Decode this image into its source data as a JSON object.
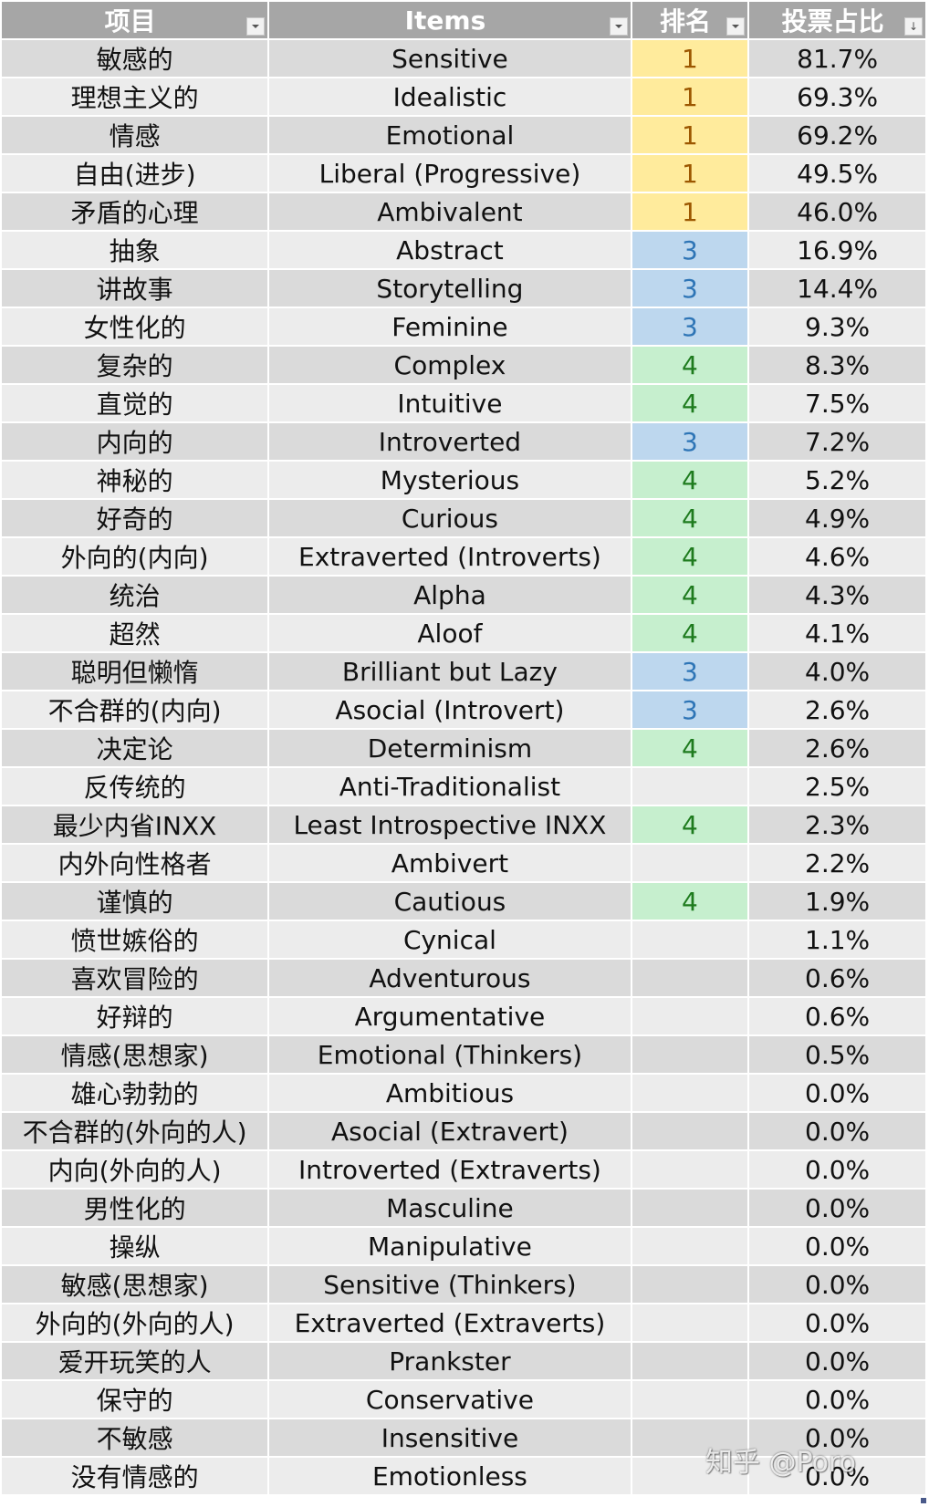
{
  "header": {
    "col_cn": "项目",
    "col_en": "Items",
    "col_rank": "排名",
    "col_pct": "投票占比",
    "filter_icon": "dropdown-triangle",
    "sort_icon": "sort-descending",
    "sort_glyph": "↓"
  },
  "colors": {
    "rank_1_bg": "#ffeb9c",
    "rank_1_text": "#9c5700",
    "rank_3_bg": "#bdd7ee",
    "rank_3_text": "#2e75b6",
    "rank_4_bg": "#c6efce",
    "rank_4_text": "#1e7b1e",
    "header_bg": "#a6a6a6"
  },
  "rows": [
    {
      "cn": "敏感的",
      "en": "Sensitive",
      "rank": "1",
      "pct": "81.7%"
    },
    {
      "cn": "理想主义的",
      "en": "Idealistic",
      "rank": "1",
      "pct": "69.3%"
    },
    {
      "cn": "情感",
      "en": "Emotional",
      "rank": "1",
      "pct": "69.2%"
    },
    {
      "cn": "自由(进步)",
      "en": "Liberal (Progressive)",
      "rank": "1",
      "pct": "49.5%"
    },
    {
      "cn": "矛盾的心理",
      "en": "Ambivalent",
      "rank": "1",
      "pct": "46.0%"
    },
    {
      "cn": "抽象",
      "en": "Abstract",
      "rank": "3",
      "pct": "16.9%"
    },
    {
      "cn": "讲故事",
      "en": "Storytelling",
      "rank": "3",
      "pct": "14.4%"
    },
    {
      "cn": "女性化的",
      "en": "Feminine",
      "rank": "3",
      "pct": "9.3%"
    },
    {
      "cn": "复杂的",
      "en": "Complex",
      "rank": "4",
      "pct": "8.3%"
    },
    {
      "cn": "直觉的",
      "en": "Intuitive",
      "rank": "4",
      "pct": "7.5%"
    },
    {
      "cn": "内向的",
      "en": "Introverted",
      "rank": "3",
      "pct": "7.2%"
    },
    {
      "cn": "神秘的",
      "en": "Mysterious",
      "rank": "4",
      "pct": "5.2%"
    },
    {
      "cn": "好奇的",
      "en": "Curious",
      "rank": "4",
      "pct": "4.9%"
    },
    {
      "cn": "外向的(内向)",
      "en": "Extraverted (Introverts)",
      "rank": "4",
      "pct": "4.6%"
    },
    {
      "cn": "统治",
      "en": "Alpha",
      "rank": "4",
      "pct": "4.3%"
    },
    {
      "cn": "超然",
      "en": "Aloof",
      "rank": "4",
      "pct": "4.1%"
    },
    {
      "cn": "聪明但懒惰",
      "en": "Brilliant but Lazy",
      "rank": "3",
      "pct": "4.0%"
    },
    {
      "cn": "不合群的(内向)",
      "en": "Asocial (Introvert)",
      "rank": "3",
      "pct": "2.6%"
    },
    {
      "cn": "决定论",
      "en": "Determinism",
      "rank": "4",
      "pct": "2.6%"
    },
    {
      "cn": "反传统的",
      "en": "Anti-Traditionalist",
      "rank": "",
      "pct": "2.5%"
    },
    {
      "cn": "最少内省INXX",
      "en": "Least Introspective INXX",
      "rank": "4",
      "pct": "2.3%"
    },
    {
      "cn": "内外向性格者",
      "en": "Ambivert",
      "rank": "",
      "pct": "2.2%"
    },
    {
      "cn": "谨慎的",
      "en": "Cautious",
      "rank": "4",
      "pct": "1.9%"
    },
    {
      "cn": "愤世嫉俗的",
      "en": "Cynical",
      "rank": "",
      "pct": "1.1%"
    },
    {
      "cn": "喜欢冒险的",
      "en": "Adventurous",
      "rank": "",
      "pct": "0.6%"
    },
    {
      "cn": "好辩的",
      "en": "Argumentative",
      "rank": "",
      "pct": "0.6%"
    },
    {
      "cn": "情感(思想家)",
      "en": "Emotional (Thinkers)",
      "rank": "",
      "pct": "0.5%"
    },
    {
      "cn": "雄心勃勃的",
      "en": "Ambitious",
      "rank": "",
      "pct": "0.0%"
    },
    {
      "cn": "不合群的(外向的人)",
      "en": "Asocial (Extravert)",
      "rank": "",
      "pct": "0.0%"
    },
    {
      "cn": "内向(外向的人)",
      "en": "Introverted (Extraverts)",
      "rank": "",
      "pct": "0.0%"
    },
    {
      "cn": "男性化的",
      "en": "Masculine",
      "rank": "",
      "pct": "0.0%"
    },
    {
      "cn": "操纵",
      "en": "Manipulative",
      "rank": "",
      "pct": "0.0%"
    },
    {
      "cn": "敏感(思想家)",
      "en": "Sensitive (Thinkers)",
      "rank": "",
      "pct": "0.0%"
    },
    {
      "cn": "外向的(外向的人)",
      "en": "Extraverted (Extraverts)",
      "rank": "",
      "pct": "0.0%"
    },
    {
      "cn": "爱开玩笑的人",
      "en": "Prankster",
      "rank": "",
      "pct": "0.0%"
    },
    {
      "cn": "保守的",
      "en": "Conservative",
      "rank": "",
      "pct": "0.0%"
    },
    {
      "cn": "不敏感",
      "en": "Insensitive",
      "rank": "",
      "pct": "0.0%"
    },
    {
      "cn": "没有情感的",
      "en": "Emotionless",
      "rank": "",
      "pct": "0.0%"
    }
  ],
  "watermark": "知乎 @Poro"
}
